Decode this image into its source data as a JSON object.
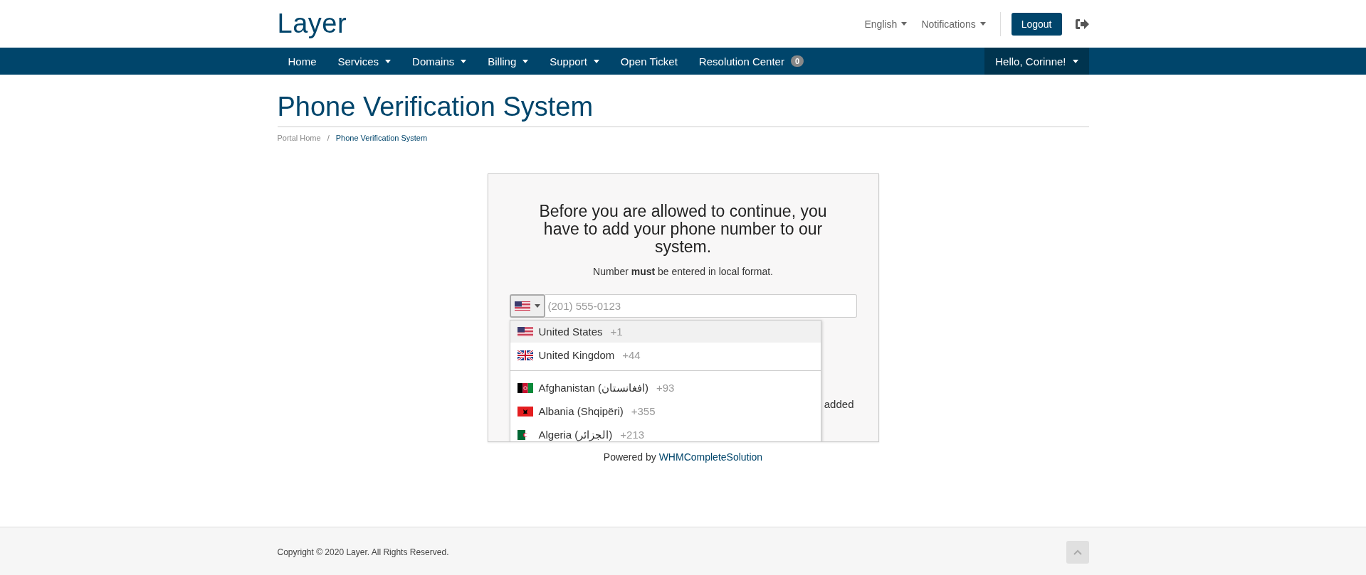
{
  "header": {
    "logo": "Layer",
    "language": "English",
    "notifications": "Notifications",
    "logout": "Logout"
  },
  "nav": {
    "items": [
      {
        "label": "Home",
        "dropdown": false
      },
      {
        "label": "Services",
        "dropdown": true
      },
      {
        "label": "Domains",
        "dropdown": true
      },
      {
        "label": "Billing",
        "dropdown": true
      },
      {
        "label": "Support",
        "dropdown": true
      },
      {
        "label": "Open Ticket",
        "dropdown": false
      },
      {
        "label": "Resolution Center",
        "dropdown": false,
        "badge": "0"
      }
    ],
    "user": "Hello, Corinne!"
  },
  "page_title": "Phone Verification System",
  "breadcrumb": [
    {
      "label": "Portal Home",
      "selected": false
    },
    {
      "separator": "/",
      "label": "Phone Verification System",
      "selected": true
    }
  ],
  "card": {
    "heading": "Before you are allowed to continue, you have to add your phone number to our system.",
    "note": "Number **must** be entered in local format.",
    "phone": {
      "kind": "us",
      "placeholder": "(201) 555-0123"
    },
    "countries": [
      {
        "kind": "us",
        "name": "United States",
        "code": "+1",
        "selected": true
      },
      {
        "kind": "gb",
        "name": "United Kingdom",
        "code": "+44",
        "selected": false
      },
      {
        "kind": "divider"
      },
      {
        "kind": "af",
        "name": "Afghanistan (افغانستان)",
        "code": "+93",
        "selected": false
      },
      {
        "kind": "al",
        "name": "Albania (Shqipëri)",
        "code": "+355",
        "selected": false
      },
      {
        "kind": "dz",
        "name": "Algeria (الجزائر)",
        "code": "+213",
        "selected": false
      }
    ],
    "hidden_text": "added"
  },
  "powered": {
    "text": "Powered by",
    "link": "WHMCompleteSolution"
  },
  "footer": {
    "copyright": "Copyright © 2020 Layer. All Rights Reserved."
  }
}
